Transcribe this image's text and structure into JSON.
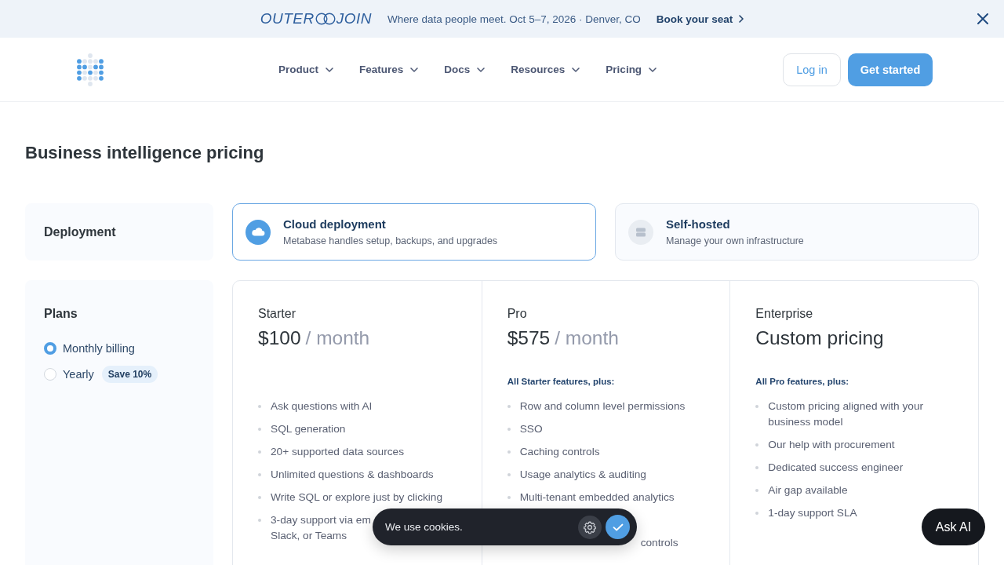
{
  "announcement_bar": {
    "event_logo": {
      "left": "OUTER",
      "right": "JOIN"
    },
    "text": "Where data people meet. Oct 5–7, 2026 · Denver, CO",
    "link": "Book your seat"
  },
  "header": {
    "nav": [
      {
        "label": "Product",
        "has_menu": true
      },
      {
        "label": "Features",
        "has_menu": true
      },
      {
        "label": "Docs",
        "has_menu": true
      },
      {
        "label": "Resources",
        "has_menu": true
      },
      {
        "label": "Pricing",
        "has_menu": true
      }
    ],
    "buttons": [
      {
        "label": "Log in",
        "kind": "outline"
      },
      {
        "label": "Get started",
        "kind": "primary"
      }
    ]
  },
  "page_title": "Business intelligence pricing",
  "deployment": {
    "label": "Deployment",
    "options": [
      {
        "kind": "cloud",
        "title": "Cloud deployment",
        "description": "Metabase handles setup, backups, and upgrades",
        "selected": true
      },
      {
        "kind": "server",
        "title": "Self-hosted",
        "description": "Manage your own infrastructure",
        "selected": false
      }
    ]
  },
  "plans": {
    "label": "Plans",
    "billing": [
      {
        "label": "Monthly billing",
        "selected": true
      },
      {
        "label": "Yearly",
        "selected": false,
        "badge": "Save 10%"
      }
    ]
  },
  "tiers": [
    {
      "name": "Starter",
      "price": "$100",
      "period": "/ month",
      "features": [
        {
          "kind": "bullet",
          "text": "Ask questions with AI"
        },
        {
          "kind": "bullet",
          "text": "SQL generation"
        },
        {
          "kind": "bullet",
          "text": "20+ supported data sources"
        },
        {
          "kind": "bullet",
          "text": "Unlimited questions & dashboards"
        },
        {
          "kind": "bullet",
          "text": "Write SQL or explore just by clicking"
        },
        {
          "kind": "bullet",
          "text": "3-day support via em",
          "continued": "Slack, or Teams"
        }
      ]
    },
    {
      "name": "Pro",
      "price": "$575",
      "period": "/ month",
      "includes": "All Starter features, plus:",
      "features": [
        {
          "kind": "bullet",
          "text": "Row and column level permissions"
        },
        {
          "kind": "bullet",
          "text": "SSO"
        },
        {
          "kind": "bullet",
          "text": "Caching controls"
        },
        {
          "kind": "bullet",
          "text": "Usage analytics & auditing"
        },
        {
          "kind": "bullet",
          "text": "Multi-tenant embedded analytics"
        },
        {
          "kind": "hidden"
        },
        {
          "kind": "clipped",
          "text": "controls"
        }
      ]
    },
    {
      "name": "Enterprise",
      "price": "Custom pricing",
      "includes": "All Pro features, plus:",
      "features": [
        {
          "kind": "bullet",
          "text": "Custom pricing aligned with your business model"
        },
        {
          "kind": "bullet",
          "text": "Our help with procurement"
        },
        {
          "kind": "bullet",
          "text": "Dedicated success engineer"
        },
        {
          "kind": "bullet",
          "text": "Air gap available"
        },
        {
          "kind": "bullet",
          "text": "1-day support SLA"
        }
      ]
    }
  ],
  "cookie_banner": {
    "text": "We use cookies."
  },
  "ask_ai_button": "Ask AI"
}
